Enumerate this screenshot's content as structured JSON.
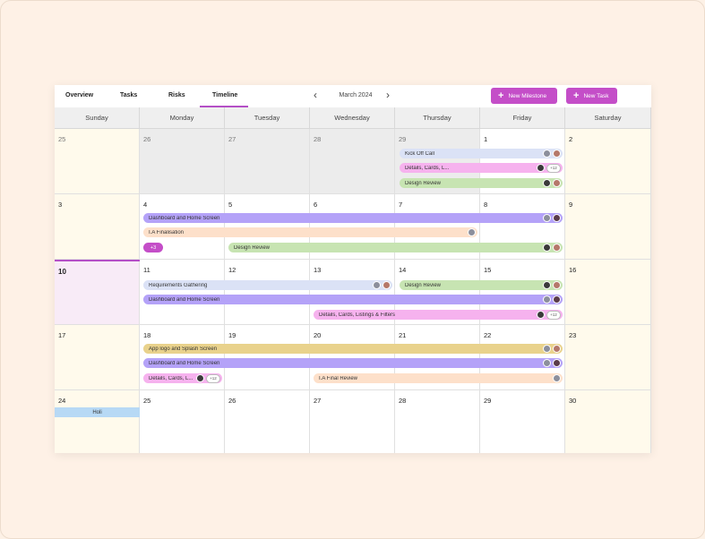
{
  "tabs": [
    {
      "label": "Overview"
    },
    {
      "label": "Tasks"
    },
    {
      "label": "Risks"
    },
    {
      "label": "Timeline"
    }
  ],
  "month_label": "March 2024",
  "buttons": {
    "new_milestone": "New Milestone",
    "new_task": "New Task"
  },
  "weekdays": [
    "Sunday",
    "Monday",
    "Tuesday",
    "Wednesday",
    "Thursday",
    "Friday",
    "Saturday"
  ],
  "weeks": [
    [
      "25",
      "26",
      "27",
      "28",
      "29",
      "1",
      "2"
    ],
    [
      "3",
      "4",
      "5",
      "6",
      "7",
      "8",
      "9"
    ],
    [
      "10",
      "11",
      "12",
      "13",
      "14",
      "15",
      "16"
    ],
    [
      "17",
      "18",
      "19",
      "20",
      "21",
      "22",
      "23"
    ],
    [
      "24",
      "25",
      "26",
      "27",
      "28",
      "29",
      "30"
    ]
  ],
  "events": {
    "kick_off": "Kick Off Call",
    "details_cards_1": "Details, Cards, L...",
    "details_cards_1_more": "+12",
    "design_review_1": "Design Review",
    "dashboard_1": "Dashboard and Home Screen",
    "ia_finalisation": "I.A Finalisation",
    "more_count": "+3",
    "design_review_2": "Design Review",
    "requirements": "Requirements Gathering",
    "design_review_3": "Design Review",
    "dashboard_2": "Dashboard and Home Screen",
    "details_listings": "Details, Cards, Listings & Filters",
    "details_listings_more": "+12",
    "app_logo": "App logo and Splash Screen",
    "dashboard_3": "Dashboard and Home Screen",
    "details_cards_2": "Details, Cards, L...",
    "details_cards_2_more": "+12",
    "ia_final_review": "I.A Final Review",
    "holi": "Holi"
  },
  "colors": {
    "accent": "#c44ec8",
    "today_bg": "#f8ebf7",
    "weekend_bg": "#fffaec"
  }
}
